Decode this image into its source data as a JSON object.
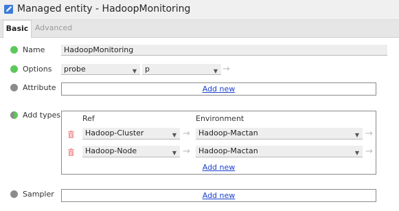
{
  "window": {
    "title": "Managed entity - HadoopMonitoring",
    "title_icon": "pencil-edit-icon"
  },
  "tabs": [
    {
      "label": "Basic",
      "active": true
    },
    {
      "label": "Advanced",
      "active": false
    }
  ],
  "rows": {
    "name": {
      "label": "Name",
      "status": "green",
      "value": "HadoopMonitoring"
    },
    "options": {
      "label": "Options",
      "status": "green",
      "probe_value": "probe",
      "p_value": "p"
    },
    "attribute": {
      "label": "Attribute",
      "status": "grey",
      "add_new": "Add new"
    },
    "add_types": {
      "label": "Add types",
      "status": "partial",
      "col_ref": "Ref",
      "col_environment": "Environment",
      "items": [
        {
          "ref": "Hadoop-Cluster",
          "environment": "Hadoop-Mactan"
        },
        {
          "ref": "Hadoop-Node",
          "environment": "Hadoop-Mactan"
        }
      ],
      "add_new": "Add new"
    },
    "sampler": {
      "label": "Sampler",
      "status": "grey",
      "add_new": "Add new"
    }
  },
  "colors": {
    "status_green": "#5cc85a",
    "status_grey": "#8c8c8c",
    "link": "#1a3fcf",
    "delete_icon": "#f29999"
  }
}
